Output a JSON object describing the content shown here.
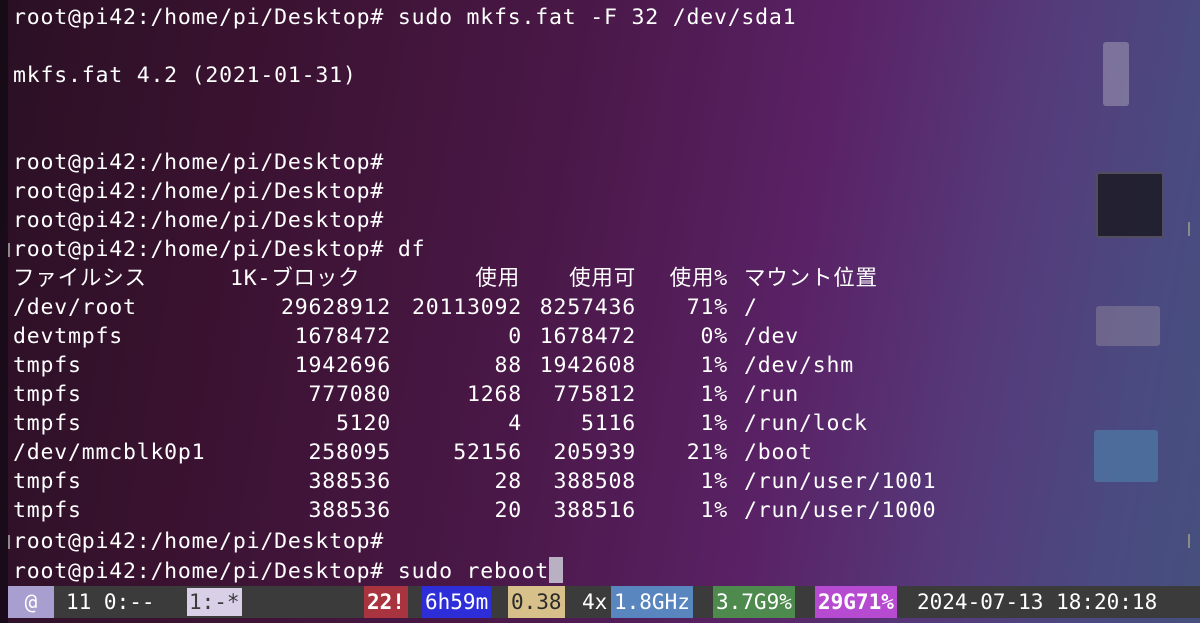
{
  "terminal": {
    "lines": [
      "root@pi42:/home/pi/Desktop# sudo mkfs.fat -F 32 /dev/sda1",
      "",
      "mkfs.fat 4.2 (2021-01-31)",
      "",
      "",
      "root@pi42:/home/pi/Desktop#",
      "root@pi42:/home/pi/Desktop#",
      "root@pi42:/home/pi/Desktop#",
      "root@pi42:/home/pi/Desktop# df"
    ],
    "df": {
      "headers": {
        "filesystem": "ファイルシス",
        "blocks": "1K-ブロック",
        "used": "使用",
        "available": "使用可",
        "use_percent": "使用%",
        "mounted_on": "マウント位置"
      },
      "rows": [
        {
          "filesystem": "/dev/root",
          "blocks": "29628912",
          "used": "20113092",
          "available": "8257436",
          "use_percent": "71%",
          "mounted_on": "/"
        },
        {
          "filesystem": "devtmpfs",
          "blocks": "1678472",
          "used": "0",
          "available": "1678472",
          "use_percent": "0%",
          "mounted_on": "/dev"
        },
        {
          "filesystem": "tmpfs",
          "blocks": "1942696",
          "used": "88",
          "available": "1942608",
          "use_percent": "1%",
          "mounted_on": "/dev/shm"
        },
        {
          "filesystem": "tmpfs",
          "blocks": "777080",
          "used": "1268",
          "available": "775812",
          "use_percent": "1%",
          "mounted_on": "/run"
        },
        {
          "filesystem": "tmpfs",
          "blocks": "5120",
          "used": "4",
          "available": "5116",
          "use_percent": "1%",
          "mounted_on": "/run/lock"
        },
        {
          "filesystem": "/dev/mmcblk0p1",
          "blocks": "258095",
          "used": "52156",
          "available": "205939",
          "use_percent": "21%",
          "mounted_on": "/boot"
        },
        {
          "filesystem": "tmpfs",
          "blocks": "388536",
          "used": "28",
          "available": "388508",
          "use_percent": "1%",
          "mounted_on": "/run/user/1001"
        },
        {
          "filesystem": "tmpfs",
          "blocks": "388536",
          "used": "20",
          "available": "388516",
          "use_percent": "1%",
          "mounted_on": "/run/user/1000"
        }
      ]
    },
    "after_lines": [
      "root@pi42:/home/pi/Desktop#",
      "root@pi42:/home/pi/Desktop# sudo reboot"
    ]
  },
  "statusbar": {
    "session_marker": "@",
    "window_index": "11 0:--",
    "window_name": "1:-*",
    "alert_count": "22!",
    "uptime": "6h59m",
    "load": "0.38",
    "cpu_count": "4x",
    "cpu_freq": "1.8GHz",
    "memory": "3.7G9%",
    "disk": "29G71%",
    "datetime": "2024-07-13 18:20:18",
    "colors": {
      "bar_bg": "#3b3b3b",
      "session_bg": "#a89fd0",
      "window_name_bg": "#d9d0e8",
      "alert_bg": "#a8343f",
      "uptime_bg": "#2e2ed8",
      "load_bg": "#d8c08a",
      "cpu_freq_bg": "#5a86c0",
      "memory_bg": "#4e8a4e",
      "disk_bg": "#b64ad0"
    }
  }
}
